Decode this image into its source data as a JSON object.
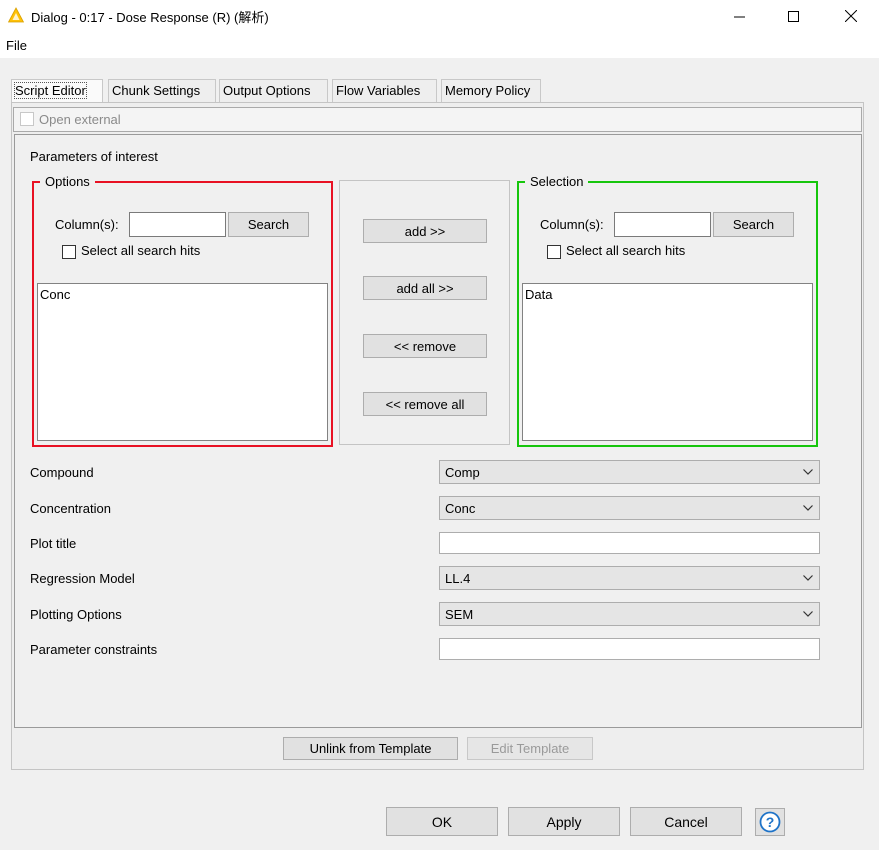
{
  "window": {
    "title": "Dialog - 0:17 - Dose Response (R) (解析)",
    "menu_file": "File"
  },
  "tabs": [
    {
      "label": "Script Editor",
      "active": true
    },
    {
      "label": "Chunk Settings",
      "active": false
    },
    {
      "label": "Output Options",
      "active": false
    },
    {
      "label": "Flow Variables",
      "active": false
    },
    {
      "label": "Memory Policy",
      "active": false
    }
  ],
  "open_external": {
    "label": "Open external",
    "checked": false,
    "enabled": false
  },
  "params": {
    "label": "Parameters of interest",
    "options": {
      "title": "Options",
      "column_label": "Column(s):",
      "column_value": "",
      "search_button": "Search",
      "select_all_label": "Select all search hits",
      "items": [
        "Conc"
      ]
    },
    "selection": {
      "title": "Selection",
      "column_label": "Column(s):",
      "column_value": "",
      "search_button": "Search",
      "select_all_label": "Select all search hits",
      "items": [
        "Data"
      ]
    },
    "buttons": {
      "add": "add >>",
      "add_all": "add all >>",
      "remove": "<< remove",
      "remove_all": "<< remove all"
    }
  },
  "fields": {
    "compound": {
      "label": "Compound",
      "value": "Comp"
    },
    "concentration": {
      "label": "Concentration",
      "value": "Conc"
    },
    "plot_title": {
      "label": "Plot title",
      "value": ""
    },
    "regression_model": {
      "label": "Regression Model",
      "value": "LL.4"
    },
    "plotting_options": {
      "label": "Plotting Options",
      "value": "SEM"
    },
    "parameter_constraints": {
      "label": "Parameter constraints",
      "value": ""
    }
  },
  "template_buttons": {
    "unlink": "Unlink from Template",
    "edit": "Edit Template"
  },
  "footer": {
    "ok": "OK",
    "apply": "Apply",
    "cancel": "Cancel",
    "help": "?"
  },
  "colors": {
    "options_border": "#e81123",
    "selection_border": "#16c60c",
    "help_accent": "#1e73c8",
    "app_icon": "#ffc107"
  }
}
